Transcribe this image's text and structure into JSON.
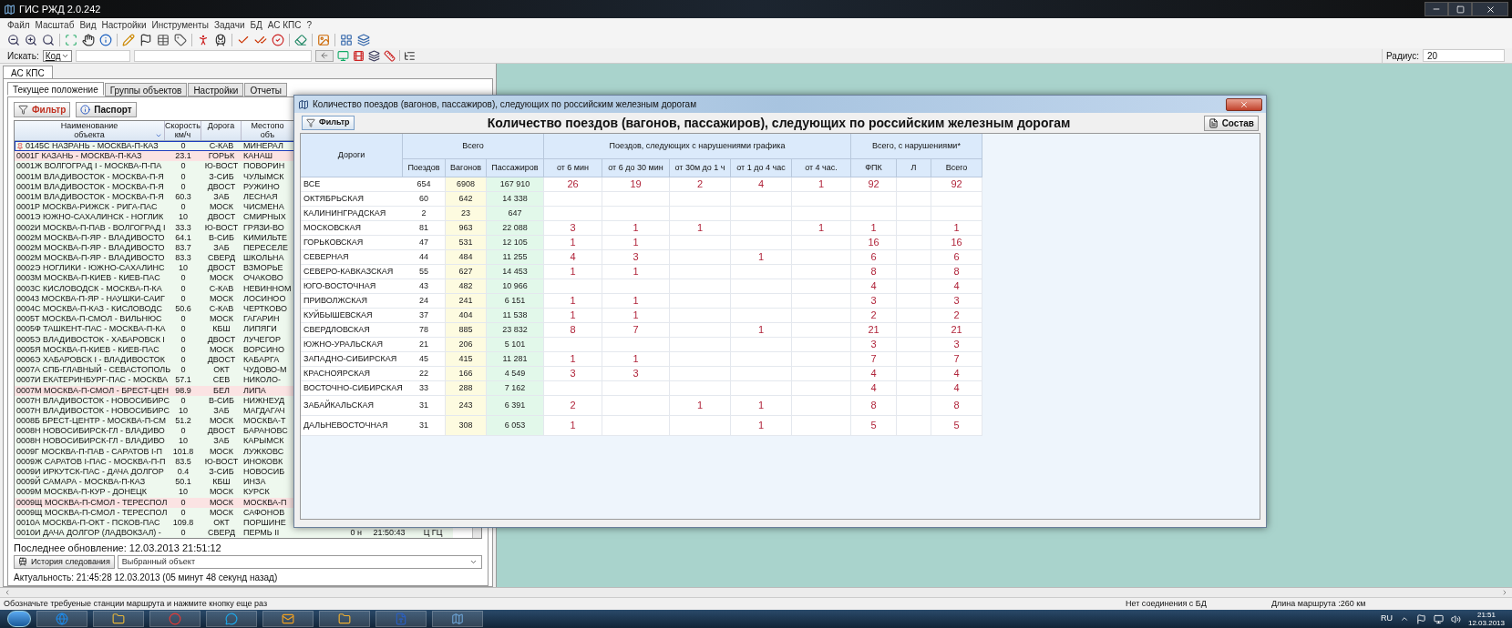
{
  "window": {
    "title": "ГИС РЖД 2.0.242"
  },
  "menu": [
    "Файл",
    "Масштаб",
    "Вид",
    "Настройки",
    "Инструменты",
    "Задачи",
    "БД",
    "АС КПС",
    "?"
  ],
  "search": {
    "label": "Искать:",
    "field_type": "Код",
    "radius_label": "Радиус:",
    "radius_value": "20"
  },
  "left_panel": {
    "tab": "АС КПС",
    "subtabs": [
      {
        "label": "Текущее положение",
        "selected": true
      },
      {
        "label": "Группы объектов",
        "selected": false
      },
      {
        "label": "Настройки",
        "selected": false
      },
      {
        "label": "Отчеты",
        "selected": false
      }
    ],
    "filter_button": "Фильтр",
    "passport_button": "Паспорт",
    "columns": [
      "Наименование\nобъекта",
      "Скорость\nкм/ч",
      "Дорога",
      "Местопо\nобъ"
    ],
    "rows": [
      {
        "name": "0145С НАЗРАНЬ - МОСКВА-П-КАЗ",
        "speed": "0",
        "road": "С-КАВ",
        "location": "МИНЕРАЛ",
        "highlighted": false,
        "selected": true
      },
      {
        "name": "0001Г КАЗАНЬ - МОСКВА-П-КАЗ",
        "speed": "23.1",
        "road": "ГОРЬК",
        "location": "КАНАШ",
        "highlighted": true,
        "selected": false
      },
      {
        "name": "0001Ж ВОЛГОГРАД I - МОСКВА-П-ПА",
        "speed": "0",
        "road": "Ю-ВОСТ",
        "location": "ПОВОРИН",
        "highlighted": false,
        "selected": false
      },
      {
        "name": "0001М ВЛАДИВОСТОК - МОСКВА-П-Я",
        "speed": "0",
        "road": "З-СИБ",
        "location": "ЧУЛЫМСК",
        "highlighted": false,
        "selected": false
      },
      {
        "name": "0001М ВЛАДИВОСТОК - МОСКВА-П-Я",
        "speed": "0",
        "road": "ДВОСТ",
        "location": "РУЖИНО",
        "highlighted": false,
        "selected": false
      },
      {
        "name": "0001М ВЛАДИВОСТОК - МОСКВА-П-Я",
        "speed": "60.3",
        "road": "ЗАБ",
        "location": "ЛЕСНАЯ",
        "highlighted": false,
        "selected": false
      },
      {
        "name": "0001Р МОСКВА-РИЖСК - РИГА-ПАС",
        "speed": "0",
        "road": "МОСК",
        "location": "ЧИСМЕНА",
        "highlighted": false,
        "selected": false
      },
      {
        "name": "0001Э ЮЖНО-САХАЛИНСК - НОГЛИК",
        "speed": "10",
        "road": "ДВОСТ",
        "location": "СМИРНЫХ",
        "highlighted": false,
        "selected": false
      },
      {
        "name": "0002И МОСКВА-П-ПАВ - ВОЛГОГРАД I",
        "speed": "33.3",
        "road": "Ю-ВОСТ",
        "location": "ГРЯЗИ-ВО",
        "highlighted": false,
        "selected": false
      },
      {
        "name": "0002М МОСКВА-П-ЯР - ВЛАДИВОСТО",
        "speed": "64.1",
        "road": "В-СИБ",
        "location": "КИМИЛЬТЕ",
        "highlighted": false,
        "selected": false
      },
      {
        "name": "0002М МОСКВА-П-ЯР - ВЛАДИВОСТО",
        "speed": "83.7",
        "road": "ЗАБ",
        "location": "ПЕРЕСЕЛЕ",
        "highlighted": false,
        "selected": false
      },
      {
        "name": "0002М МОСКВА-П-ЯР - ВЛАДИВОСТО",
        "speed": "83.3",
        "road": "СВЕРД",
        "location": "ШКОЛЬНА",
        "highlighted": false,
        "selected": false
      },
      {
        "name": "0002Э НОГЛИКИ - ЮЖНО-САХАЛИНС",
        "speed": "10",
        "road": "ДВОСТ",
        "location": "ВЗМОРЬЕ",
        "highlighted": false,
        "selected": false
      },
      {
        "name": "0003М МОСКВА-П-КИЕВ - КИЕВ-ПАС",
        "speed": "0",
        "road": "МОСК",
        "location": "ОЧАКОВО",
        "highlighted": false,
        "selected": false
      },
      {
        "name": "0003С КИСЛОВОДСК - МОСКВА-П-КА",
        "speed": "0",
        "road": "С-КАВ",
        "location": "НЕВИННОМ",
        "highlighted": false,
        "selected": false
      },
      {
        "name": "00043 МОСКВА-П-ЯР - НАУШКИ-САИГ",
        "speed": "0",
        "road": "МОСК",
        "location": "ЛОСИНОО",
        "highlighted": false,
        "selected": false
      },
      {
        "name": "0004С МОСКВА-П-КАЗ - КИСЛОВОДС",
        "speed": "50.6",
        "road": "С-КАВ",
        "location": "ЧЕРТКОВО",
        "highlighted": false,
        "selected": false
      },
      {
        "name": "0005Т МОСКВА-П-СМОЛ - ВИЛЬНЮС",
        "speed": "0",
        "road": "МОСК",
        "location": "ГАГАРИН",
        "highlighted": false,
        "selected": false
      },
      {
        "name": "0005Ф ТАШКЕНТ-ПАС - МОСКВА-П-КА",
        "speed": "0",
        "road": "КБШ",
        "location": "ЛИПЯГИ",
        "highlighted": false,
        "selected": false
      },
      {
        "name": "0005Э ВЛАДИВОСТОК - ХАБАРОВСК I",
        "speed": "0",
        "road": "ДВОСТ",
        "location": "ЛУЧЕГОР",
        "highlighted": false,
        "selected": false
      },
      {
        "name": "0005Я МОСКВА-П-КИЕВ - КИЕВ-ПАС",
        "speed": "0",
        "road": "МОСК",
        "location": "ВОРСИНО",
        "highlighted": false,
        "selected": false
      },
      {
        "name": "0006Э ХАБАРОВСК I - ВЛАДИВОСТОК",
        "speed": "0",
        "road": "ДВОСТ",
        "location": "КАБАРГА",
        "highlighted": false,
        "selected": false
      },
      {
        "name": "0007А СПБ-ГЛАВНЫЙ - СЕВАСТОПОЛЬ",
        "speed": "0",
        "road": "ОКТ",
        "location": "ЧУДОВО-М",
        "highlighted": false,
        "selected": false
      },
      {
        "name": "0007И ЕКАТЕРИНБУРГ-ПАС - МОСКВА",
        "speed": "57.1",
        "road": "СЕВ",
        "location": "НИКОЛО-",
        "highlighted": false,
        "selected": false
      },
      {
        "name": "0007М МОСКВА-П-СМОЛ - БРЕСТ-ЦЕН",
        "speed": "98.9",
        "road": "БЕЛ",
        "location": "ЛИПА",
        "highlighted": true,
        "selected": false
      },
      {
        "name": "0007Н ВЛАДИВОСТОК - НОВОСИБИРС",
        "speed": "0",
        "road": "В-СИБ",
        "location": "НИЖНЕУД",
        "highlighted": false,
        "selected": false
      },
      {
        "name": "0007Н ВЛАДИВОСТОК - НОВОСИБИРС",
        "speed": "10",
        "road": "ЗАБ",
        "location": "МАГДАГАЧ",
        "highlighted": false,
        "selected": false
      },
      {
        "name": "0008Б БРЕСТ-ЦЕНТР - МОСКВА-П-СМ",
        "speed": "51.2",
        "road": "МОСК",
        "location": "МОСКВА-Т",
        "highlighted": false,
        "selected": false
      },
      {
        "name": "0008Н НОВОСИБИРСК-ГЛ - ВЛАДИВО",
        "speed": "0",
        "road": "ДВОСТ",
        "location": "БАРАНОВС",
        "highlighted": false,
        "selected": false
      },
      {
        "name": "0008Н НОВОСИБИРСК-ГЛ - ВЛАДИВО",
        "speed": "10",
        "road": "ЗАБ",
        "location": "КАРЫМСК",
        "highlighted": false,
        "selected": false
      },
      {
        "name": "0009Г МОСКВА-П-ПАВ - САРАТОВ I-П",
        "speed": "101.8",
        "road": "МОСК",
        "location": "ЛУЖКОВС",
        "highlighted": false,
        "selected": false
      },
      {
        "name": "0009Ж САРАТОВ I-ПАС - МОСКВА-П-П",
        "speed": "83.5",
        "road": "Ю-ВОСТ",
        "location": "ИНОКОВК",
        "highlighted": false,
        "selected": false
      },
      {
        "name": "0009И ИРКУТСК-ПАС - ДАЧА ДОЛГОР",
        "speed": "0.4",
        "road": "З-СИБ",
        "location": "НОВОСИБ",
        "highlighted": false,
        "selected": false
      },
      {
        "name": "0009Й САМАРА - МОСКВА-П-КАЗ",
        "speed": "50.1",
        "road": "КБШ",
        "location": "ИНЗА",
        "highlighted": false,
        "selected": false
      },
      {
        "name": "0009М МОСКВА-П-КУР - ДОНЕЦК",
        "speed": "10",
        "road": "МОСК",
        "location": "КУРСК",
        "highlighted": false,
        "selected": false
      },
      {
        "name": "0009Щ МОСКВА-П-СМОЛ - ТЕРЕСПОЛ",
        "speed": "0",
        "road": "МОСК",
        "location": "МОСКВА-П",
        "highlighted": true,
        "selected": false
      },
      {
        "name": "0009Щ МОСКВА-П-СМОЛ - ТЕРЕСПОЛ",
        "speed": "0",
        "road": "МОСК",
        "location": "САФОНОВ",
        "highlighted": false,
        "selected": false
      },
      {
        "name": "0010А МОСКВА-П-ОКТ - ПСКОВ-ПАС",
        "speed": "109.8",
        "road": "ОКТ",
        "location": "ПОРШИНЕ",
        "highlighted": false,
        "selected": false
      },
      {
        "name": "0010И ДАЧА ДОЛГОР (ЛАДВОКЗАЛ) -",
        "speed": "0",
        "road": "СВЕРД",
        "location": "ПЕРМЬ II",
        "highlighted": false,
        "selected": false,
        "tail": [
          "0 н",
          "21:50:43",
          "Ц ГЦ"
        ]
      }
    ],
    "last_update": "Последнее обновление: 12.03.2013 21:51:12",
    "history_button": "История следования",
    "object_select": "Выбранный объект",
    "actuality": "Актуальность: 21:45:28 12.03.2013 (05 минут 48 секунд назад)"
  },
  "dialog": {
    "title": "Количество поездов (вагонов, пассажиров), следующих по российским железным дорогам",
    "filter_button": "Фильтр",
    "heading": "Количество поездов (вагонов, пассажиров), следующих по российским железным дорогам",
    "compose_button": "Состав",
    "road_header": "Дороги",
    "groups": [
      {
        "label": "Всего",
        "columns": [
          "Поездов",
          "Вагонов",
          "Пассажиров"
        ]
      },
      {
        "label": "Поездов, следующих с нарушениями графика",
        "columns": [
          "от 6 мин",
          "от 6 до 30 мин",
          "от 30м до 1 ч",
          "от 1 до 4 час",
          "от 4 час."
        ]
      },
      {
        "label": "Всего, с нарушениями*",
        "columns": [
          "ФПК",
          "Л",
          "Всего"
        ]
      }
    ],
    "rows": [
      {
        "road": "ВСЕ",
        "cells": [
          "654",
          "6908",
          "167 910",
          "26",
          "19",
          "2",
          "4",
          "1",
          "92",
          null,
          "92"
        ]
      },
      {
        "road": "ОКТЯБРЬСКАЯ",
        "cells": [
          "60",
          "642",
          "14 338",
          null,
          null,
          null,
          null,
          null,
          null,
          null,
          null
        ]
      },
      {
        "road": "КАЛИНИНГРАДСКАЯ",
        "cells": [
          "2",
          "23",
          "647",
          null,
          null,
          null,
          null,
          null,
          null,
          null,
          null
        ]
      },
      {
        "road": "МОСКОВСКАЯ",
        "cells": [
          "81",
          "963",
          "22 088",
          "3",
          "1",
          "1",
          null,
          "1",
          "1",
          null,
          "1"
        ]
      },
      {
        "road": "ГОРЬКОВСКАЯ",
        "cells": [
          "47",
          "531",
          "12 105",
          "1",
          "1",
          null,
          null,
          null,
          "16",
          null,
          "16"
        ]
      },
      {
        "road": "СЕВЕРНАЯ",
        "cells": [
          "44",
          "484",
          "11 255",
          "4",
          "3",
          null,
          "1",
          null,
          "6",
          null,
          "6"
        ]
      },
      {
        "road": "СЕВЕРО-КАВКАЗСКАЯ",
        "cells": [
          "55",
          "627",
          "14 453",
          "1",
          "1",
          null,
          null,
          null,
          "8",
          null,
          "8"
        ]
      },
      {
        "road": "ЮГО-ВОСТОЧНАЯ",
        "cells": [
          "43",
          "482",
          "10 966",
          null,
          null,
          null,
          null,
          null,
          "4",
          null,
          "4"
        ]
      },
      {
        "road": "ПРИВОЛЖСКАЯ",
        "cells": [
          "24",
          "241",
          "6 151",
          "1",
          "1",
          null,
          null,
          null,
          "3",
          null,
          "3"
        ]
      },
      {
        "road": "КУЙБЫШЕВСКАЯ",
        "cells": [
          "37",
          "404",
          "11 538",
          "1",
          "1",
          null,
          null,
          null,
          "2",
          null,
          "2"
        ]
      },
      {
        "road": "СВЕРДЛОВСКАЯ",
        "cells": [
          "78",
          "885",
          "23 832",
          "8",
          "7",
          null,
          "1",
          null,
          "21",
          null,
          "21"
        ]
      },
      {
        "road": "ЮЖНО-УРАЛЬСКАЯ",
        "cells": [
          "21",
          "206",
          "5 101",
          null,
          null,
          null,
          null,
          null,
          "3",
          null,
          "3"
        ]
      },
      {
        "road": "ЗАПАДНО-СИБИРСКАЯ",
        "cells": [
          "45",
          "415",
          "11 281",
          "1",
          "1",
          null,
          null,
          null,
          "7",
          null,
          "7"
        ]
      },
      {
        "road": "КРАСНОЯРСКАЯ",
        "cells": [
          "22",
          "166",
          "4 549",
          "3",
          "3",
          null,
          null,
          null,
          "4",
          null,
          "4"
        ]
      },
      {
        "road": "ВОСТОЧНО-СИБИРСКАЯ",
        "cells": [
          "33",
          "288",
          "7 162",
          null,
          null,
          null,
          null,
          null,
          "4",
          null,
          "4"
        ]
      },
      {
        "road": "ЗАБАЙКАЛЬСКАЯ",
        "cells": [
          "31",
          "243",
          "6 391",
          "2",
          null,
          "1",
          "1",
          null,
          "8",
          null,
          "8"
        ]
      },
      {
        "road": "ДАЛЬНЕВОСТОЧНАЯ",
        "cells": [
          "31",
          "308",
          "6 053",
          "1",
          null,
          null,
          "1",
          null,
          "5",
          null,
          "5"
        ]
      }
    ]
  },
  "status_bar": {
    "hint": "Обозначьте требуеные станции маршрута и нажмите кнопку еще раз",
    "connection": "Нет соединения с БД",
    "route_length": "Длина маршрута :260 км"
  },
  "taskbar": {
    "language": "RU",
    "time": "21:51",
    "date": "12.03.2013"
  }
}
